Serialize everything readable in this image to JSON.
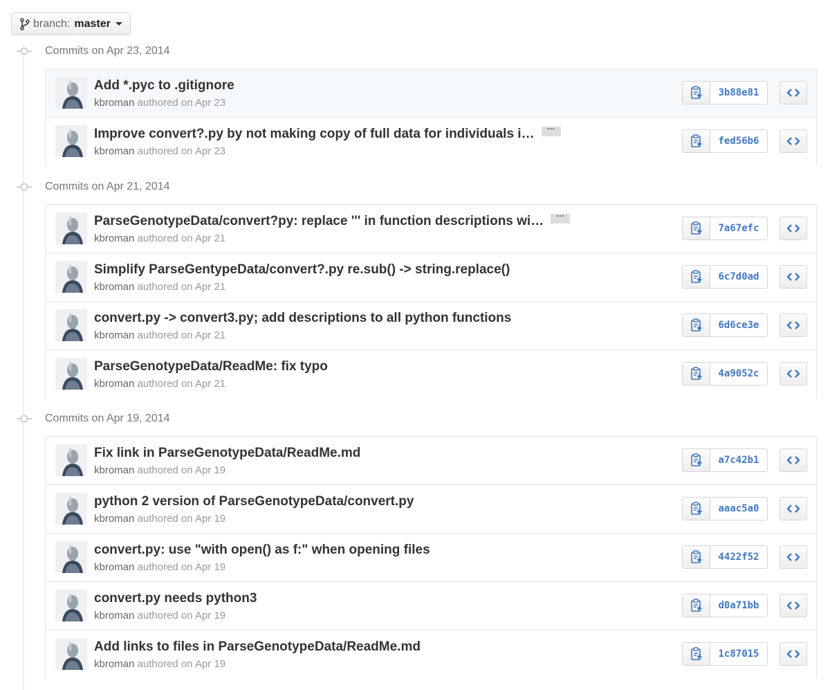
{
  "branch": {
    "prefix": "branch:",
    "name": "master"
  },
  "groups": [
    {
      "title": "Commits on Apr 23, 2014",
      "commits": [
        {
          "title": "Add *.pyc to .gitignore",
          "author": "kbroman",
          "authored": "authored on Apr 23",
          "sha": "3b88e81",
          "truncated": false,
          "highlighted": true
        },
        {
          "title": "Improve convert?.py by not making copy of full data for individuals i…",
          "author": "kbroman",
          "authored": "authored on Apr 23",
          "sha": "fed56b6",
          "truncated": true,
          "highlighted": false
        }
      ]
    },
    {
      "title": "Commits on Apr 21, 2014",
      "commits": [
        {
          "title": "ParseGenotypeData/convert?py: replace ''' in function descriptions wi…",
          "author": "kbroman",
          "authored": "authored on Apr 21",
          "sha": "7a67efc",
          "truncated": true,
          "highlighted": false
        },
        {
          "title": "Simplify ParseGentypeData/convert?.py re.sub() -> string.replace()",
          "author": "kbroman",
          "authored": "authored on Apr 21",
          "sha": "6c7d0ad",
          "truncated": false,
          "highlighted": false
        },
        {
          "title": "convert.py -> convert3.py; add descriptions to all python functions",
          "author": "kbroman",
          "authored": "authored on Apr 21",
          "sha": "6d6ce3e",
          "truncated": false,
          "highlighted": false
        },
        {
          "title": "ParseGenotypeData/ReadMe: fix typo",
          "author": "kbroman",
          "authored": "authored on Apr 21",
          "sha": "4a9052c",
          "truncated": false,
          "highlighted": false
        }
      ]
    },
    {
      "title": "Commits on Apr 19, 2014",
      "commits": [
        {
          "title": "Fix link in ParseGenotypeData/ReadMe.md",
          "author": "kbroman",
          "authored": "authored on Apr 19",
          "sha": "a7c42b1",
          "truncated": false,
          "highlighted": false
        },
        {
          "title": "python 2 version of ParseGenotypeData/convert.py",
          "author": "kbroman",
          "authored": "authored on Apr 19",
          "sha": "aaac5a0",
          "truncated": false,
          "highlighted": false
        },
        {
          "title": "convert.py: use \"with open() as f:\" when opening files",
          "author": "kbroman",
          "authored": "authored on Apr 19",
          "sha": "4422f52",
          "truncated": false,
          "highlighted": false
        },
        {
          "title": "convert.py needs python3",
          "author": "kbroman",
          "authored": "authored on Apr 19",
          "sha": "d0a71bb",
          "truncated": false,
          "highlighted": false
        },
        {
          "title": "Add links to files in ParseGenotypeData/ReadMe.md",
          "author": "kbroman",
          "authored": "authored on Apr 19",
          "sha": "1c87015",
          "truncated": false,
          "highlighted": false
        }
      ]
    }
  ],
  "ellipsis_label": "···",
  "icons": {
    "branch": "git-branch-icon",
    "commit_dot": "git-commit-icon",
    "copy": "clippy-icon",
    "browse": "code-icon",
    "caret": "caret-down-icon"
  },
  "colors": {
    "sha": "#4078c0",
    "highlight_row": "#f5f9fb",
    "meta": "#999999"
  }
}
